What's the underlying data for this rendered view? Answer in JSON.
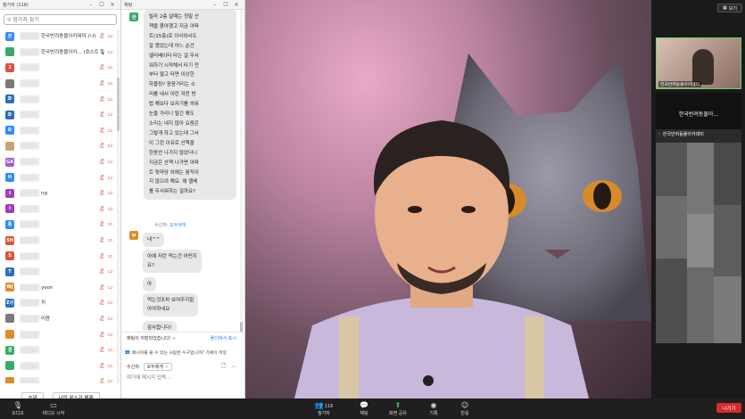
{
  "participants_panel": {
    "title": "참가자 (116)",
    "search_placeholder": "참가자 찾기",
    "rows": [
      {
        "initial": "한",
        "color": "#2d8cff",
        "name": "한국반려동물아카데미 (나)",
        "icon": "mic-muted"
      },
      {
        "initial": "",
        "color": "#3aaa6a",
        "name": "한국반려동물아카... (호스트)",
        "icon": "mic"
      },
      {
        "initial": "2",
        "color": "#e0503a",
        "name": "",
        "icon": "mic-muted"
      },
      {
        "initial": "",
        "color": "#7a7a7a",
        "name": "",
        "icon": "mic-muted"
      },
      {
        "initial": "D",
        "color": "#2d6fbf",
        "name": "",
        "icon": "mic-muted"
      },
      {
        "initial": "D",
        "color": "#2d6fbf",
        "name": "",
        "icon": "mic-muted"
      },
      {
        "initial": "D",
        "color": "#2d8cff",
        "name": "",
        "icon": "mic-muted"
      },
      {
        "initial": "",
        "color": "#c9a27a",
        "name": "",
        "icon": "mic-muted"
      },
      {
        "initial": "GA",
        "color": "#a060c8",
        "name": "",
        "icon": "mic-muted"
      },
      {
        "initial": "H",
        "color": "#2d8cff",
        "name": "",
        "icon": "mic-muted"
      },
      {
        "initial": "I",
        "color": "#a040b0",
        "name": "ng",
        "icon": "mic-muted"
      },
      {
        "initial": "I",
        "color": "#a040b0",
        "name": "",
        "icon": "mic-muted"
      },
      {
        "initial": "종",
        "color": "#2d8cff",
        "name": "",
        "icon": "mic-muted"
      },
      {
        "initial": "SH",
        "color": "#e0503a",
        "name": "",
        "icon": "mic-muted"
      },
      {
        "initial": "S",
        "color": "#e0503a",
        "name": "",
        "icon": "mic-muted"
      },
      {
        "initial": "T",
        "color": "#2d6fbf",
        "name": "",
        "icon": "mic-muted"
      },
      {
        "initial": "WJ",
        "color": "#e08a2a",
        "name": "yeon",
        "icon": "mic-muted"
      },
      {
        "initial": "Z사",
        "color": "#2d6fbf",
        "name": "치",
        "icon": "mic-muted"
      },
      {
        "initial": "",
        "color": "#7a7a7a",
        "name": "미용",
        "icon": "mic-muted"
      },
      {
        "initial": "",
        "color": "#e08a2a",
        "name": "",
        "icon": "mic-muted"
      },
      {
        "initial": "경",
        "color": "#3aaa6a",
        "name": "",
        "icon": "mic-muted"
      },
      {
        "initial": "",
        "color": "#3aaa6a",
        "name": "",
        "icon": "mic-muted"
      },
      {
        "initial": "",
        "color": "#e08a2a",
        "name": "",
        "icon": "mic-muted"
      }
    ],
    "invite_label": "초대",
    "unmute_all_label": "나만 음소거 해제"
  },
  "chat_panel": {
    "title": "채팅",
    "first_message_lines": [
      "빌라 2층 살때는 정말 산",
      "책을 좋아했고 지금 아파",
      "트(15층)로 이사와서도",
      "잘 했었는데 어느 순간",
      "엘리베이터 타는 걸 무서",
      "워하기 시작해서 타기 전",
      "부터 떨고 타면 이상한",
      "하울링? 응응거리는 소",
      "리를 내서 이런 저런 방",
      "법 해보다 보자기를 씌워",
      "눈을 가리니 떨긴 해도",
      "소리는 내지 않아 요즘은",
      "그렇게 하고 있는데 그사",
      "이 그런 이유로 산책을",
      "한동안 나가지 않았더니",
      "지금은 산책 나가면 아파",
      "트 뒷마당 외에는 움직이",
      "지 않으려 해요. 왜 옐베",
      "를 무서워하는 걸까요?"
    ],
    "to_prefix": "수신자:",
    "to_target": "모두에게",
    "second_avatar": "부",
    "messages": [
      "네^^",
      "아예 저런 먹는건 어떤지\n요?",
      "아",
      "먹는것조차 보여주지말\n아야하네요",
      "감사합니다!"
    ],
    "saved_status": "채팅이 저장되었습니다! ✓",
    "open_folder_label": "폴더에서 표시",
    "notice_text": "메시지를 볼 수 있는 사람은 누구입니까? 기록이 저장",
    "recipient_label": "수신자:",
    "recipient_value": "모두에게",
    "input_placeholder": "여기에 메시지 입력..."
  },
  "gallery": {
    "view_label": "보기",
    "tile1_name": "한국반려동물아카데미",
    "tile2_name": "한국반려동물아...",
    "tile3_name": "한국반려동물아카데미"
  },
  "toolbar": {
    "mute_label": "오디오",
    "video_label": "비디오 시작",
    "participants_label": "참가자",
    "participants_count": "116",
    "chat_label": "채팅",
    "share_label": "화면 공유",
    "record_label": "기록",
    "reactions_label": "반응",
    "leave_label": "나가기"
  },
  "colors": {
    "accent": "#2d8cff",
    "mute_red": "#e02828",
    "share_green": "#33c15a",
    "leave_red": "#d72b2b"
  }
}
